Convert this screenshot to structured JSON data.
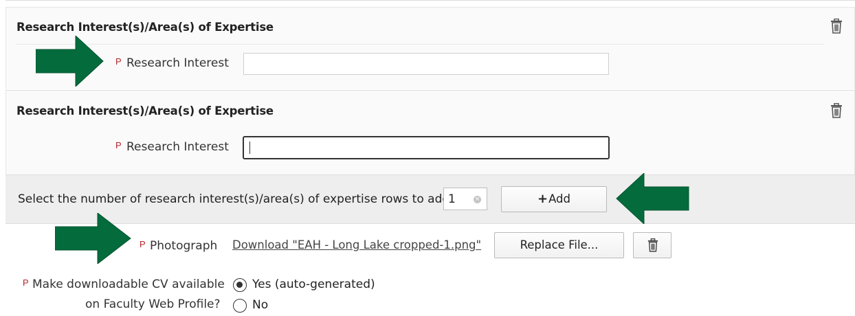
{
  "sections": [
    {
      "title": "Research Interest(s)/Area(s) of Expertise",
      "required_marker": "P",
      "field_label": "Research Interest",
      "value": ""
    },
    {
      "title": "Research Interest(s)/Area(s) of Expertise",
      "required_marker": "P",
      "field_label": "Research Interest",
      "value": ""
    }
  ],
  "add_rows": {
    "label": "Select the number of research interest(s)/area(s) of expertise rows to add:",
    "count": "1",
    "clear_glyph": "×",
    "plus_glyph": "+",
    "button_label": "Add"
  },
  "photograph": {
    "required_marker": "P",
    "label": "Photograph",
    "download_link": "Download \"EAH - Long Lake cropped-1.png\"",
    "replace_button": "Replace File..."
  },
  "cv": {
    "required_marker": "P",
    "label_line1": "Make downloadable CV available",
    "label_line2": "on Faculty Web Profile?",
    "options": [
      {
        "label": "Yes (auto-generated)",
        "checked": true
      },
      {
        "label": "No",
        "checked": false
      }
    ]
  },
  "colors": {
    "arrow_green": "#046b3c",
    "required_red": "#b3232a",
    "panel_bg": "#fafafa",
    "add_bar_bg": "#eeeeee"
  },
  "icons": [
    "trash-icon",
    "arrow-right-icon",
    "arrow-left-icon",
    "plus-icon",
    "clear-icon"
  ]
}
